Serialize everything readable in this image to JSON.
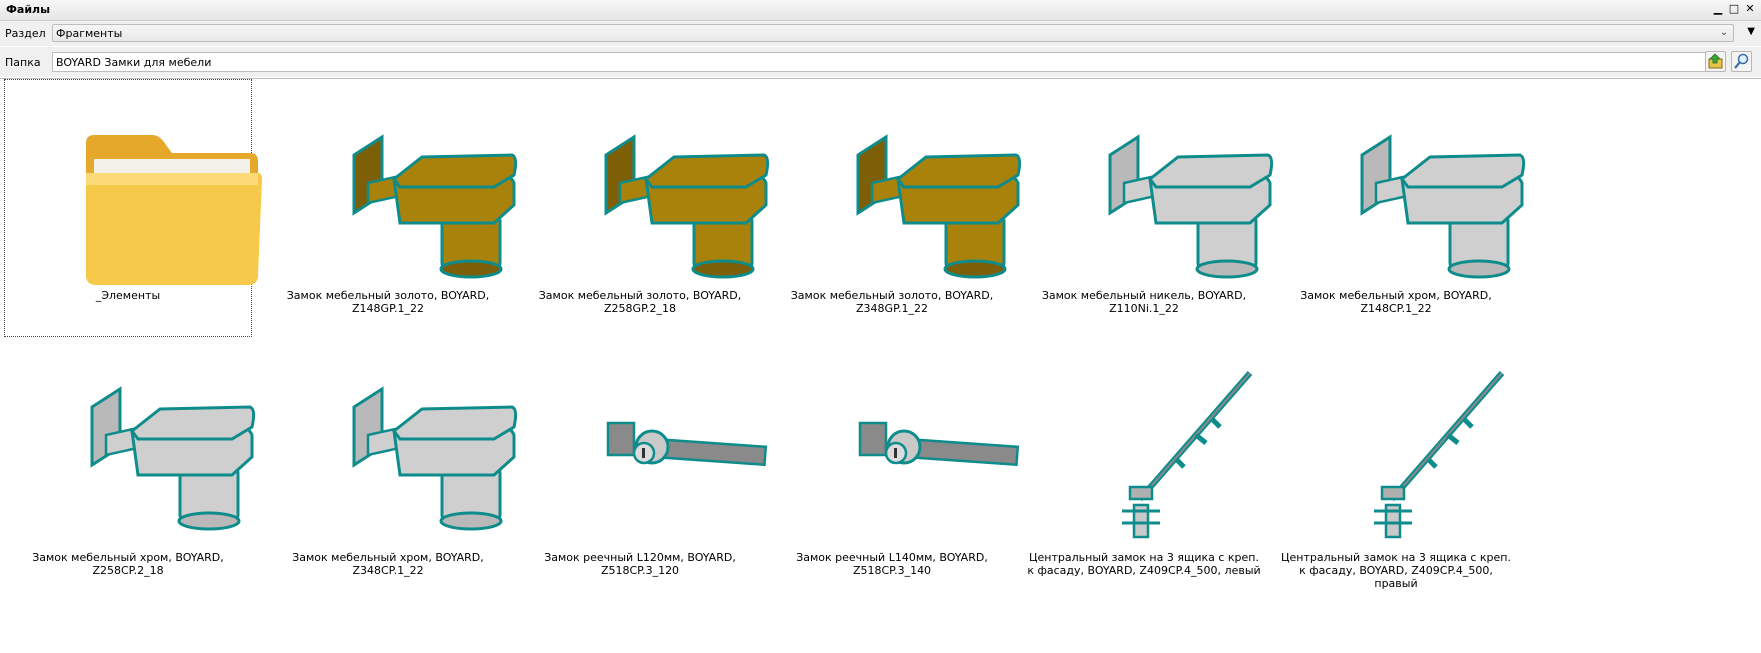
{
  "window": {
    "title": "Файлы",
    "controls": [
      "minimize-icon",
      "maximize-icon",
      "close-icon"
    ]
  },
  "section": {
    "label": "Раздел",
    "value": "Фрагменты"
  },
  "folder": {
    "label": "Папка",
    "value": "BOYARD Замки для мебели"
  },
  "items": [
    {
      "caption": "_Элементы",
      "kind": "folder"
    },
    {
      "caption": "Замок мебельный золото, BOYARD, Z148GP.1_22",
      "kind": "lock",
      "finish": "gold"
    },
    {
      "caption": "Замок мебельный золото, BOYARD, Z258GP.2_18",
      "kind": "lock",
      "finish": "gold"
    },
    {
      "caption": "Замок мебельный золото, BOYARD, Z348GP.1_22",
      "kind": "lock",
      "finish": "gold"
    },
    {
      "caption": "Замок мебельный никель, BOYARD, Z110Ni.1_22",
      "kind": "lock",
      "finish": "silver"
    },
    {
      "caption": "Замок мебельный хром, BOYARD, Z148CP.1_22",
      "kind": "lock",
      "finish": "silver"
    },
    {
      "caption": "Замок мебельный хром, BOYARD, Z258CP.2_18",
      "kind": "lock",
      "finish": "silver"
    },
    {
      "caption": "Замок мебельный хром, BOYARD, Z348CP.1_22",
      "kind": "lock",
      "finish": "silver"
    },
    {
      "caption": "Замок реечный L120мм, BOYARD, Z518CP.3_120",
      "kind": "rack"
    },
    {
      "caption": "Замок реечный L140мм, BOYARD, Z518CP.3_140",
      "kind": "rack"
    },
    {
      "caption": "Центральный замок на 3 ящика с креп. к фасаду, BOYARD, Z409CP.4_500, левый",
      "kind": "central"
    },
    {
      "caption": "Центральный замок на 3 ящика с креп. к фасаду, BOYARD, Z409CP.4_500, правый",
      "kind": "central"
    }
  ],
  "colors": {
    "outline": "#0e8c8c",
    "gold": "#a8820a",
    "silver": "#cfcfcf",
    "folder": "#f7c94a"
  }
}
